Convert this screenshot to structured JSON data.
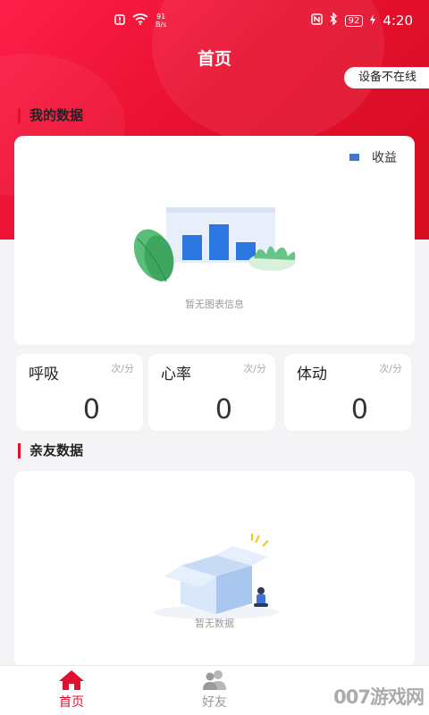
{
  "status_bar": {
    "speed_value": "91",
    "speed_unit": "B/s",
    "battery": "92",
    "time": "4:20"
  },
  "header": {
    "title": "首页",
    "device_status": "设备不在线"
  },
  "my_data": {
    "section_title": "我的数据",
    "legend_label": "收益",
    "legend_color": "#3f74d8",
    "empty_text": "暂无图表信息"
  },
  "metrics": [
    {
      "name": "呼吸",
      "unit": "次/分",
      "value": "0"
    },
    {
      "name": "心率",
      "unit": "次/分",
      "value": "0"
    },
    {
      "name": "体动",
      "unit": "次/分",
      "value": "0"
    }
  ],
  "friends": {
    "section_title": "亲友数据",
    "empty_text": "暂无数据"
  },
  "tabbar": {
    "items": [
      {
        "label": "首页",
        "icon": "home-icon",
        "active": true
      },
      {
        "label": "好友",
        "icon": "friends-icon",
        "active": false
      }
    ]
  },
  "watermark": "007游戏网",
  "colors": {
    "brand": "#e01030",
    "tab_inactive": "#999999"
  }
}
